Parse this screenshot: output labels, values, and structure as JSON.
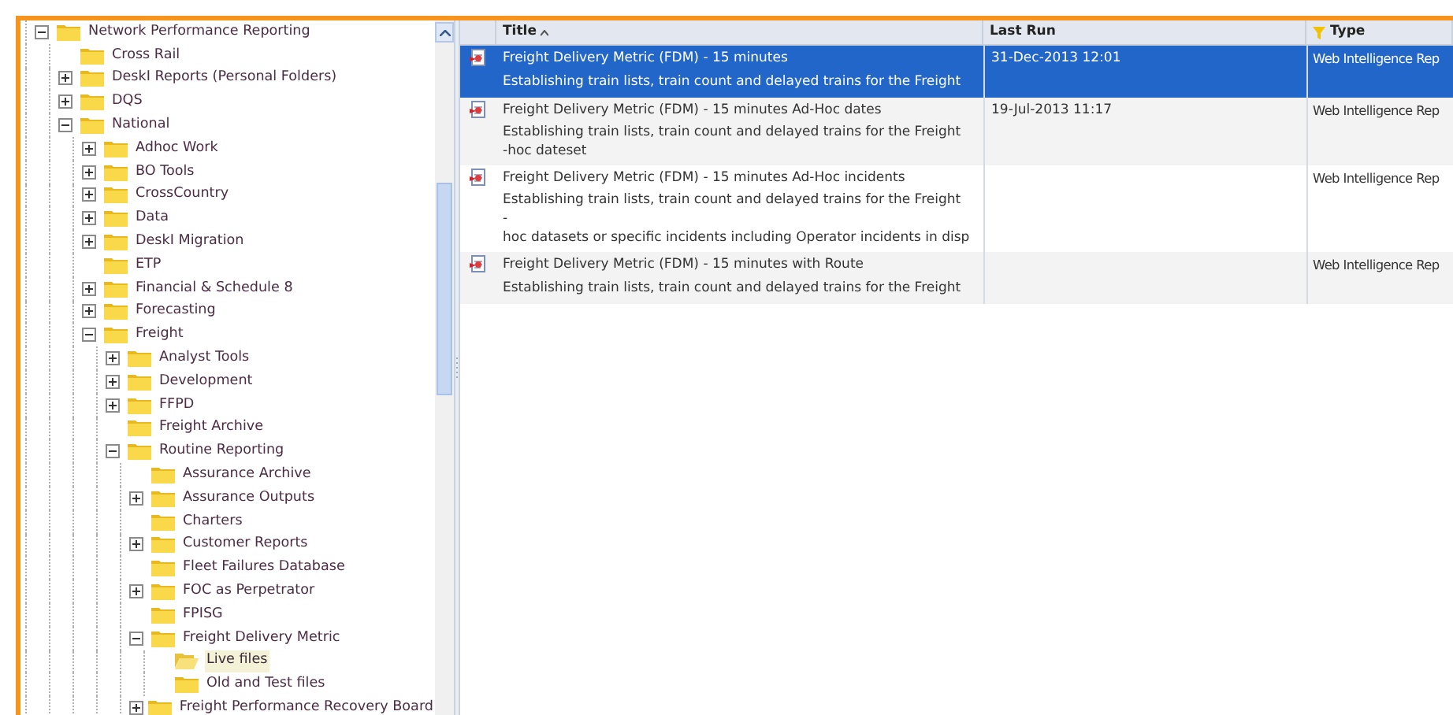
{
  "tree": [
    {
      "label": "Network Performance Reporting",
      "expanded": true,
      "selected": false,
      "children": [
        {
          "label": "Cross Rail",
          "selected": false
        },
        {
          "label": "DeskI Reports (Personal Folders)",
          "expanded": false,
          "selected": false
        },
        {
          "label": "DQS",
          "expanded": false,
          "selected": false
        },
        {
          "label": "National",
          "expanded": true,
          "selected": false,
          "children": [
            {
              "label": "Adhoc Work",
              "expanded": false,
              "selected": false
            },
            {
              "label": "BO Tools",
              "expanded": false,
              "selected": false
            },
            {
              "label": "CrossCountry",
              "expanded": false,
              "selected": false
            },
            {
              "label": "Data",
              "expanded": false,
              "selected": false
            },
            {
              "label": "DeskI Migration",
              "expanded": false,
              "selected": false
            },
            {
              "label": "ETP",
              "selected": false
            },
            {
              "label": "Financial & Schedule 8",
              "expanded": false,
              "selected": false
            },
            {
              "label": "Forecasting",
              "expanded": false,
              "selected": false
            },
            {
              "label": "Freight",
              "expanded": true,
              "selected": false,
              "children": [
                {
                  "label": "Analyst Tools",
                  "expanded": false,
                  "selected": false
                },
                {
                  "label": "Development",
                  "expanded": false,
                  "selected": false
                },
                {
                  "label": "FFPD",
                  "expanded": false,
                  "selected": false
                },
                {
                  "label": "Freight Archive",
                  "selected": false
                },
                {
                  "label": "Routine Reporting",
                  "expanded": true,
                  "selected": false,
                  "children": [
                    {
                      "label": "Assurance Archive",
                      "selected": false
                    },
                    {
                      "label": "Assurance Outputs",
                      "expanded": false,
                      "selected": false
                    },
                    {
                      "label": "Charters",
                      "selected": false
                    },
                    {
                      "label": "Customer Reports",
                      "expanded": false,
                      "selected": false
                    },
                    {
                      "label": "Fleet Failures Database",
                      "selected": false
                    },
                    {
                      "label": "FOC as Perpetrator",
                      "expanded": false,
                      "selected": false
                    },
                    {
                      "label": "FPISG",
                      "selected": false
                    },
                    {
                      "label": "Freight Delivery Metric",
                      "expanded": true,
                      "selected": false,
                      "children": [
                        {
                          "label": "Live files",
                          "selected": true
                        },
                        {
                          "label": "Old and Test files",
                          "selected": false
                        }
                      ]
                    },
                    {
                      "label": "Freight Performance Recovery Board",
                      "expanded": false,
                      "selected": false
                    }
                  ]
                }
              ]
            }
          ]
        }
      ]
    }
  ],
  "table": {
    "columns": [
      {
        "label": "Title",
        "sorted": true,
        "filtered": false
      },
      {
        "label": "Last Run",
        "sorted": false,
        "filtered": false
      },
      {
        "label": "Type",
        "sorted": false,
        "filtered": true
      }
    ],
    "rows": [
      {
        "title": "Freight Delivery Metric (FDM) - 15 minutes",
        "description": [
          "Establishing train lists, train count and delayed trains for the Freight"
        ],
        "last_run": "31-Dec-2013 12:01",
        "type": "Web Intelligence Rep",
        "selected": true
      },
      {
        "title": "Freight Delivery Metric (FDM) - 15 minutes Ad-Hoc dates",
        "description": [
          "Establishing train lists, train count and delayed trains for the Freight",
          "-hoc dateset"
        ],
        "last_run": "19-Jul-2013 11:17",
        "type": "Web Intelligence Rep",
        "selected": false
      },
      {
        "title": "Freight Delivery Metric (FDM) - 15 minutes Ad-Hoc incidents",
        "description": [
          "Establishing train lists, train count and delayed trains for the Freight",
          "-",
          "hoc datasets or specific incidents including Operator incidents in disp"
        ],
        "type": "Web Intelligence Rep",
        "selected": false
      },
      {
        "title": "Freight Delivery Metric (FDM) - 15 minutes with Route",
        "description": [
          "Establishing train lists, train count and delayed trains for the Freight"
        ],
        "type": "Web Intelligence Rep",
        "selected": false
      }
    ]
  }
}
